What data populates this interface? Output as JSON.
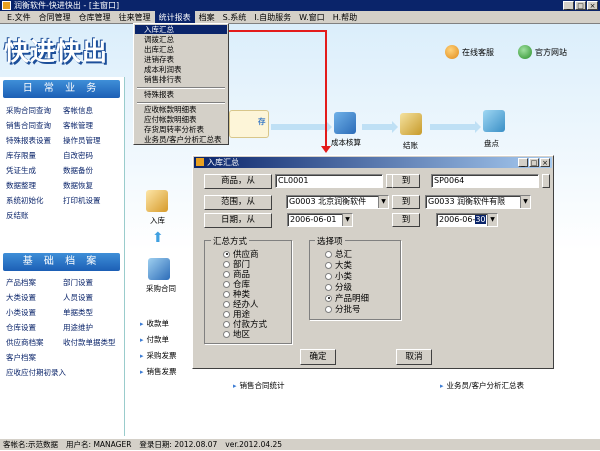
{
  "window": {
    "title": "润衡软件-快进快出 - [主窗口]",
    "controls": [
      "_",
      "□",
      "×"
    ]
  },
  "menubar": [
    "E.文件",
    "合同管理",
    "仓库管理",
    "往来管理",
    "统计报表",
    "档案",
    "S.系统",
    "I.自助服务",
    "W.窗口",
    "H.帮助"
  ],
  "logo": "快进快出",
  "top_links": {
    "online_service": "在线客服",
    "official_site": "官方网站"
  },
  "sidebar": {
    "daily": {
      "header": "日 常 业 务",
      "items": [
        "采购合同查询",
        "客帐信息",
        "销售合同查询",
        "客帐管理",
        "特殊报表设置",
        "操作员管理",
        "库存限量",
        "自改密码",
        "凭证生成",
        "数据备份",
        "数据整理",
        "数据恢复",
        "系统初始化",
        "打印机设置",
        "反结账",
        ""
      ]
    },
    "archive": {
      "header": "基 础 档 案",
      "items": [
        "产品档案",
        "部门设置",
        "大类设置",
        "人员设置",
        "小类设置",
        "单据类型",
        "仓库设置",
        "用途维护",
        "供应商档案",
        "收付款单据类型",
        "客户档案",
        "",
        "应收应付期初录入",
        ""
      ]
    }
  },
  "dropdown_menu": {
    "group1": [
      "入库汇总",
      "调拨汇总",
      "出库汇总",
      "进销存表",
      "成本利润表",
      "销售排行表"
    ],
    "group2": [
      "特殊报表"
    ],
    "group3": [
      "应收帐款明细表",
      "应付帐款明细表",
      "存货周转率分析表",
      "业务员/客户分析汇总表"
    ]
  },
  "flow": {
    "in_stock": "入库",
    "purchase_contract": "采购合同",
    "cost_accounting": "成本核算",
    "settlement": "结账",
    "inventory": "盘点",
    "cun": "存"
  },
  "bottom_links": [
    "收款单",
    "付款单",
    "采购发票",
    "销售发票",
    "销售合同统计",
    "业务员/客户分析汇总表"
  ],
  "dialog": {
    "title": "入库汇总",
    "controls": [
      "_",
      "□",
      "×"
    ],
    "product_label": "商品，从",
    "product_from": "CL0001",
    "to_label": "到",
    "product_to": "SP0064",
    "scope_label": "范围，从",
    "scope_from": "G0003  北京润衡软件",
    "scope_to": "G0033  润衡软件有限",
    "date_label": "日期，从",
    "date_from": "2006-06-01",
    "date_to_prefix": "2006-06-",
    "date_to_day": "30",
    "summary_label": "汇总方式",
    "summary_options": [
      "供应商",
      "部门",
      "商品",
      "仓库",
      "种类",
      "经办人",
      "用途",
      "付款方式",
      "地区"
    ],
    "summary_selected": 0,
    "select_label": "选择项",
    "select_options": [
      "总汇",
      "大类",
      "小类",
      "分级",
      "产品明细",
      "分批号"
    ],
    "select_selected": 4,
    "ok": "确定",
    "cancel": "取消"
  },
  "statusbar": {
    "account": "客帐名:示范数据",
    "user": "用户名: MANAGER",
    "login_date": "登录日期: 2012.08.07",
    "version": "ver.2012.04.25"
  }
}
